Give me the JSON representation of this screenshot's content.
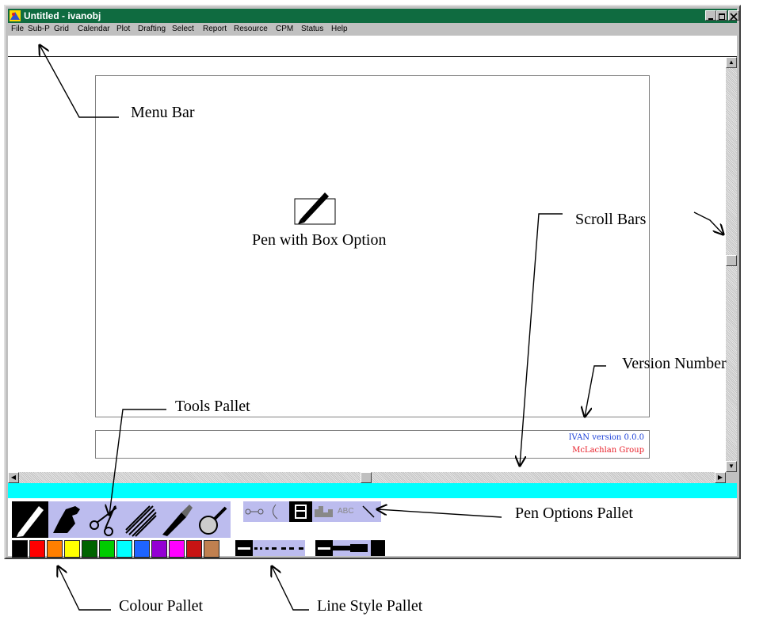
{
  "window": {
    "title": "Untitled - ivanobj"
  },
  "menu": {
    "items": [
      "File",
      "Sub-P",
      "Grid",
      "Calendar",
      "Plot",
      "Drafting",
      "Select",
      "Report",
      "Resource",
      "CPM",
      "Status",
      "Help"
    ]
  },
  "canvas": {
    "version_text": "IVAN version 0.0.0",
    "company_text": "McLachlan Group",
    "version_color": "#1a3fd8",
    "company_color": "#e8202a"
  },
  "tools": [
    "pen-icon",
    "hand-icon",
    "scissors-icon",
    "hatch-icon",
    "knife-icon",
    "magnifier-icon"
  ],
  "pen_options": [
    "link-icon",
    "arc-icon",
    "box-icon",
    "bars-icon",
    "text-abc-icon",
    "diagonal-line-icon"
  ],
  "pen_options_text": "ABC",
  "colours": [
    "#000000",
    "#ff0000",
    "#ff7f00",
    "#ffff00",
    "#006400",
    "#00cc00",
    "#00ffff",
    "#1e64ff",
    "#9400d3",
    "#ff00ff",
    "#c81414",
    "#c08050"
  ],
  "annotations": {
    "menu_bar": "Menu Bar",
    "pen_box": "Pen with Box Option",
    "scroll_bars": "Scroll Bars",
    "version_number": "Version Number",
    "tools_pallet": "Tools Pallet",
    "pen_options_pallet": "Pen Options Pallet",
    "colour_pallet": "Colour Pallet",
    "line_style_pallet": "Line Style Pallet"
  }
}
